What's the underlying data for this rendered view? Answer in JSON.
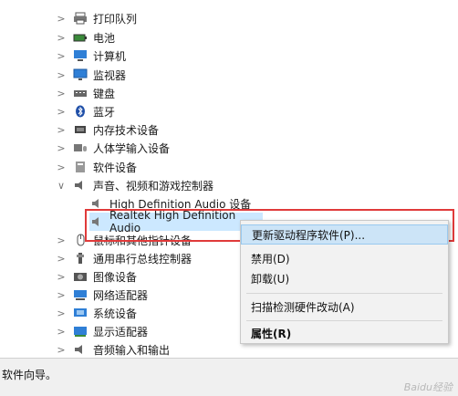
{
  "tree": {
    "items": [
      {
        "label": "打印队列",
        "icon": "printer-icon"
      },
      {
        "label": "电池",
        "icon": "battery-icon"
      },
      {
        "label": "计算机",
        "icon": "computer-icon"
      },
      {
        "label": "监视器",
        "icon": "monitor-icon"
      },
      {
        "label": "键盘",
        "icon": "keyboard-icon"
      },
      {
        "label": "蓝牙",
        "icon": "bluetooth-icon"
      },
      {
        "label": "内存技术设备",
        "icon": "memory-icon"
      },
      {
        "label": "人体学输入设备",
        "icon": "hid-icon"
      },
      {
        "label": "软件设备",
        "icon": "software-device-icon"
      },
      {
        "label": "声音、视频和游戏控制器",
        "icon": "sound-icon"
      },
      {
        "label": "鼠标和其他指针设备",
        "icon": "mouse-icon"
      },
      {
        "label": "通用串行总线控制器",
        "icon": "usb-icon"
      },
      {
        "label": "图像设备",
        "icon": "camera-icon"
      },
      {
        "label": "网络适配器",
        "icon": "network-icon"
      },
      {
        "label": "系统设备",
        "icon": "system-icon"
      },
      {
        "label": "显示适配器",
        "icon": "display-adapter-icon"
      },
      {
        "label": "音频输入和输出",
        "icon": "audio-io-icon"
      }
    ],
    "sound_children": [
      {
        "label": "High Definition Audio 设备",
        "icon": "speaker-icon"
      },
      {
        "label": "Realtek High Definition Audio",
        "icon": "speaker-icon"
      }
    ]
  },
  "context_menu": {
    "update_driver": "更新驱动程序软件(P)...",
    "disable": "禁用(D)",
    "uninstall": "卸载(U)",
    "scan": "扫描检测硬件改动(A)",
    "properties": "属性(R)"
  },
  "status_bar": {
    "text": "软件向导。"
  },
  "watermark": "Baidu经验",
  "colors": {
    "highlight_box": "#e03a3a",
    "menu_active": "#cce4f7",
    "selection": "#cce8ff"
  }
}
